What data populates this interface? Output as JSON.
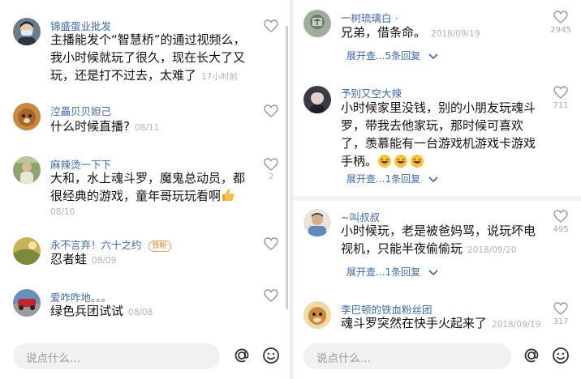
{
  "left": {
    "comments": [
      {
        "name": "锦盛蛋业批发",
        "lines": [
          "主播能发个“智慧桥”的通过视频么，",
          "我小时候就玩了很久，现在长大了又",
          "玩，还是打不过去，太难了"
        ],
        "time": "17小时前"
      },
      {
        "name": "涳畾贝贝妲己",
        "lines": [
          "什么时候直播?"
        ],
        "time": "08/11"
      },
      {
        "name": "麻辣烫一下下",
        "lines": [
          "大和，水上魂斗罗，魔鬼总动员，都",
          "很经典的游戏，童年哥玩玩看啊"
        ],
        "time": "08/10",
        "likes": "2"
      },
      {
        "name": "永不言弃！六十之约",
        "badge": "铁粉",
        "lines": [
          "忍者蛙"
        ],
        "time": "08/09"
      },
      {
        "name": "爱咋咋地。。。",
        "lines": [
          "绿色兵团试试"
        ],
        "time": "08/08"
      }
    ],
    "input_placeholder": "说点什么..."
  },
  "right": {
    "comments": [
      {
        "name": "一树琉璃白 ·",
        "lines": [
          "兄弟，借条命。"
        ],
        "time": "2018/09/19",
        "likes": "2945",
        "expand": "展开查...5条回复"
      },
      {
        "name": "予别又空大辣",
        "lines": [
          "小时候家里没钱，别的小朋友玩魂斗",
          "罗，带我去他家玩，那时候可喜欢",
          "了，羡慕能有一台游戏机游戏卡游戏",
          "手柄。"
        ],
        "likes": "711",
        "expand": "展开查...1条回复"
      },
      {
        "name": "~叫叔叔",
        "lines": [
          "小时候玩，老是被爸妈骂，说玩坏电",
          "视机，只能半夜偷偷玩"
        ],
        "time": "2018/09/20",
        "likes": "495",
        "expand": "展开查...1条回复"
      },
      {
        "name": "李巴顿的铁血粉丝团",
        "lines": [
          "魂斗罗突然在快手火起来了"
        ],
        "time": "2018/09/19",
        "likes": "317"
      }
    ],
    "input_placeholder": "说点什么..."
  },
  "colors": {
    "username": "#3f68a8",
    "timestamp": "#b3b3b3",
    "badge": "#e9a45c"
  }
}
